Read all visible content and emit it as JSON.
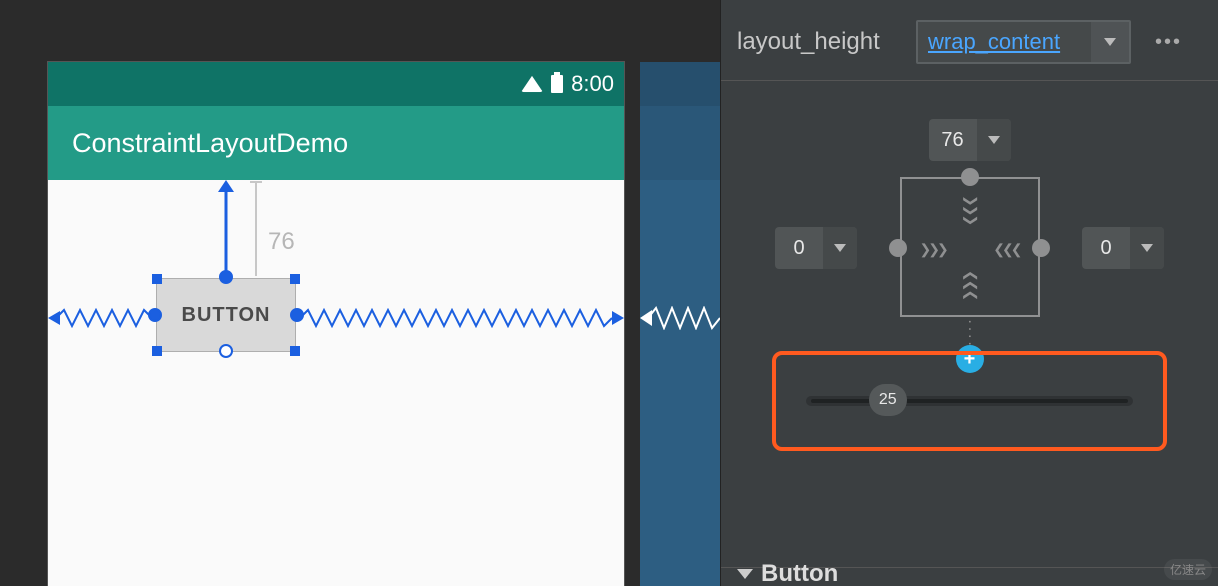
{
  "preview": {
    "time": "8:00",
    "app_title": "ConstraintLayoutDemo",
    "widget_label": "BUTTON",
    "top_margin_label": "76"
  },
  "attributes": {
    "layout_height": {
      "label": "layout_height",
      "value": "wrap_content"
    }
  },
  "constraint_editor": {
    "top_margin": "76",
    "left_margin": "0",
    "right_margin": "0",
    "horizontal_bias": "25",
    "horizontal_bias_percent": 25
  },
  "section": {
    "button_header": "Button"
  },
  "icons": {
    "wifi": "wifi-icon",
    "battery": "battery-icon",
    "add": "add-icon",
    "dropdown": "chevron-down-icon"
  },
  "watermark": "亿速云"
}
